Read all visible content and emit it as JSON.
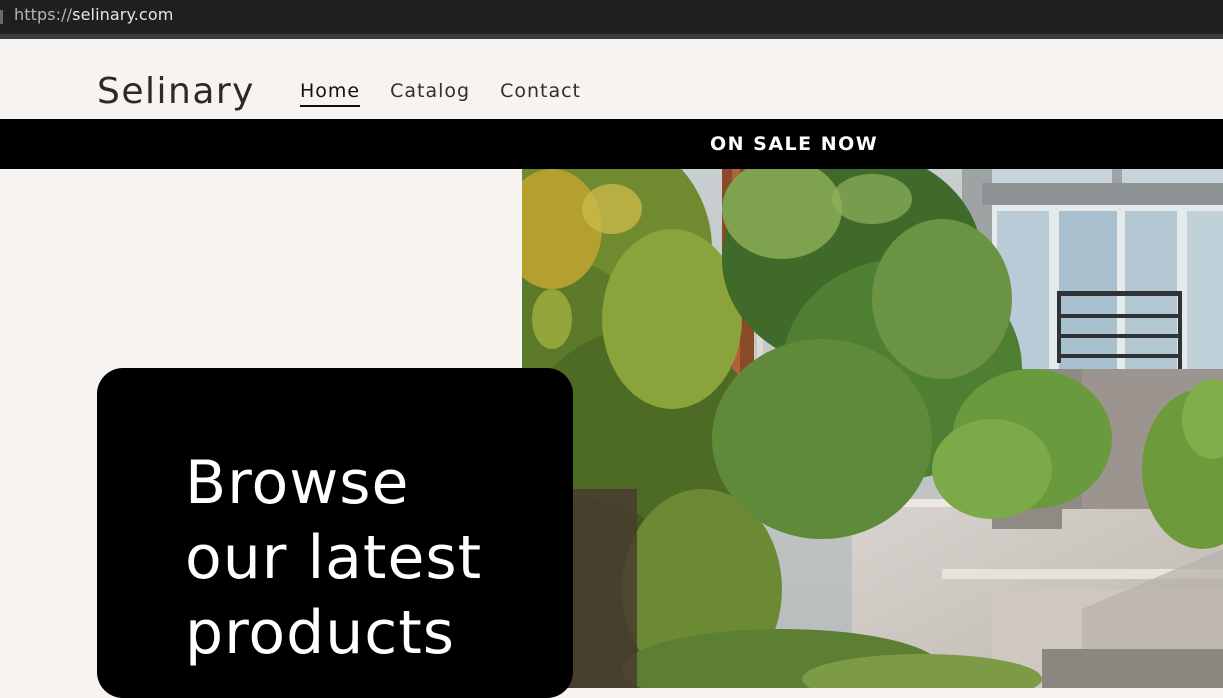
{
  "browser": {
    "url_scheme": "https://",
    "url_host": "selinary.com"
  },
  "header": {
    "logo": "Selinary",
    "nav": [
      {
        "label": "Home",
        "active": true
      },
      {
        "label": "Catalog",
        "active": false
      },
      {
        "label": "Contact",
        "active": false
      }
    ]
  },
  "banner": {
    "text": "ON SALE NOW"
  },
  "hero": {
    "title_lines": [
      "Browse",
      "our latest",
      "products"
    ],
    "image_icon": "building-with-plants-photo"
  },
  "colors": {
    "background": "#f6f3f0",
    "banner": "#000000",
    "card": "#000000",
    "text": "#2a2a2a"
  }
}
